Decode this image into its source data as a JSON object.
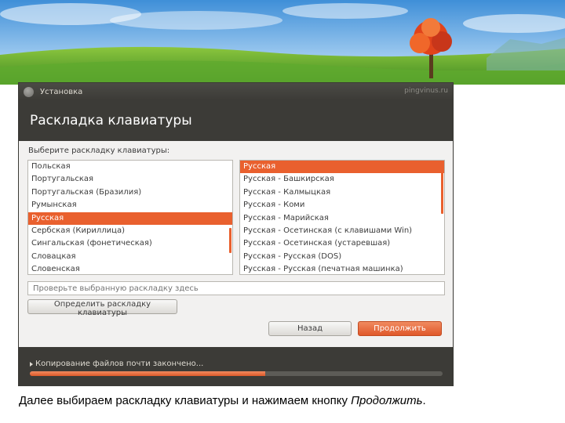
{
  "window": {
    "title": "Установка",
    "watermark": "pingvinus.ru",
    "page_title": "Раскладка клавиатуры"
  },
  "keyboard": {
    "prompt": "Выберите раскладку клавиатуры:",
    "layouts": [
      "Польская",
      "Португальская",
      "Португальская (Бразилия)",
      "Румынская",
      "Русская",
      "Сербская (Кириллица)",
      "Сингальская (фонетическая)",
      "Словацкая",
      "Словенская"
    ],
    "selected_layout": "Русская",
    "variants": [
      "Русская",
      "Русская - Башкирская",
      "Русская - Калмыцкая",
      "Русская - Коми",
      "Русская - Марийская",
      "Русская - Осетинская (с клавишами Win)",
      "Русская - Осетинская (устаревшая)",
      "Русская - Русская (DOS)",
      "Русская - Русская (печатная машинка)"
    ],
    "selected_variant": "Русская",
    "test_placeholder": "Проверьте выбранную раскладку здесь",
    "detect_label": "Определить раскладку клавиатуры"
  },
  "buttons": {
    "back": "Назад",
    "continue": "Продолжить"
  },
  "progress": {
    "label": "Копирование файлов почти закончено...",
    "fraction": 0.57
  },
  "caption": {
    "text": "Далее выбираем раскладку клавиатуры и нажимаем кнопку ",
    "emphasis": "Продолжить",
    "end": "."
  },
  "colors": {
    "accent": "#e9602e",
    "dark": "#3c3b37"
  }
}
